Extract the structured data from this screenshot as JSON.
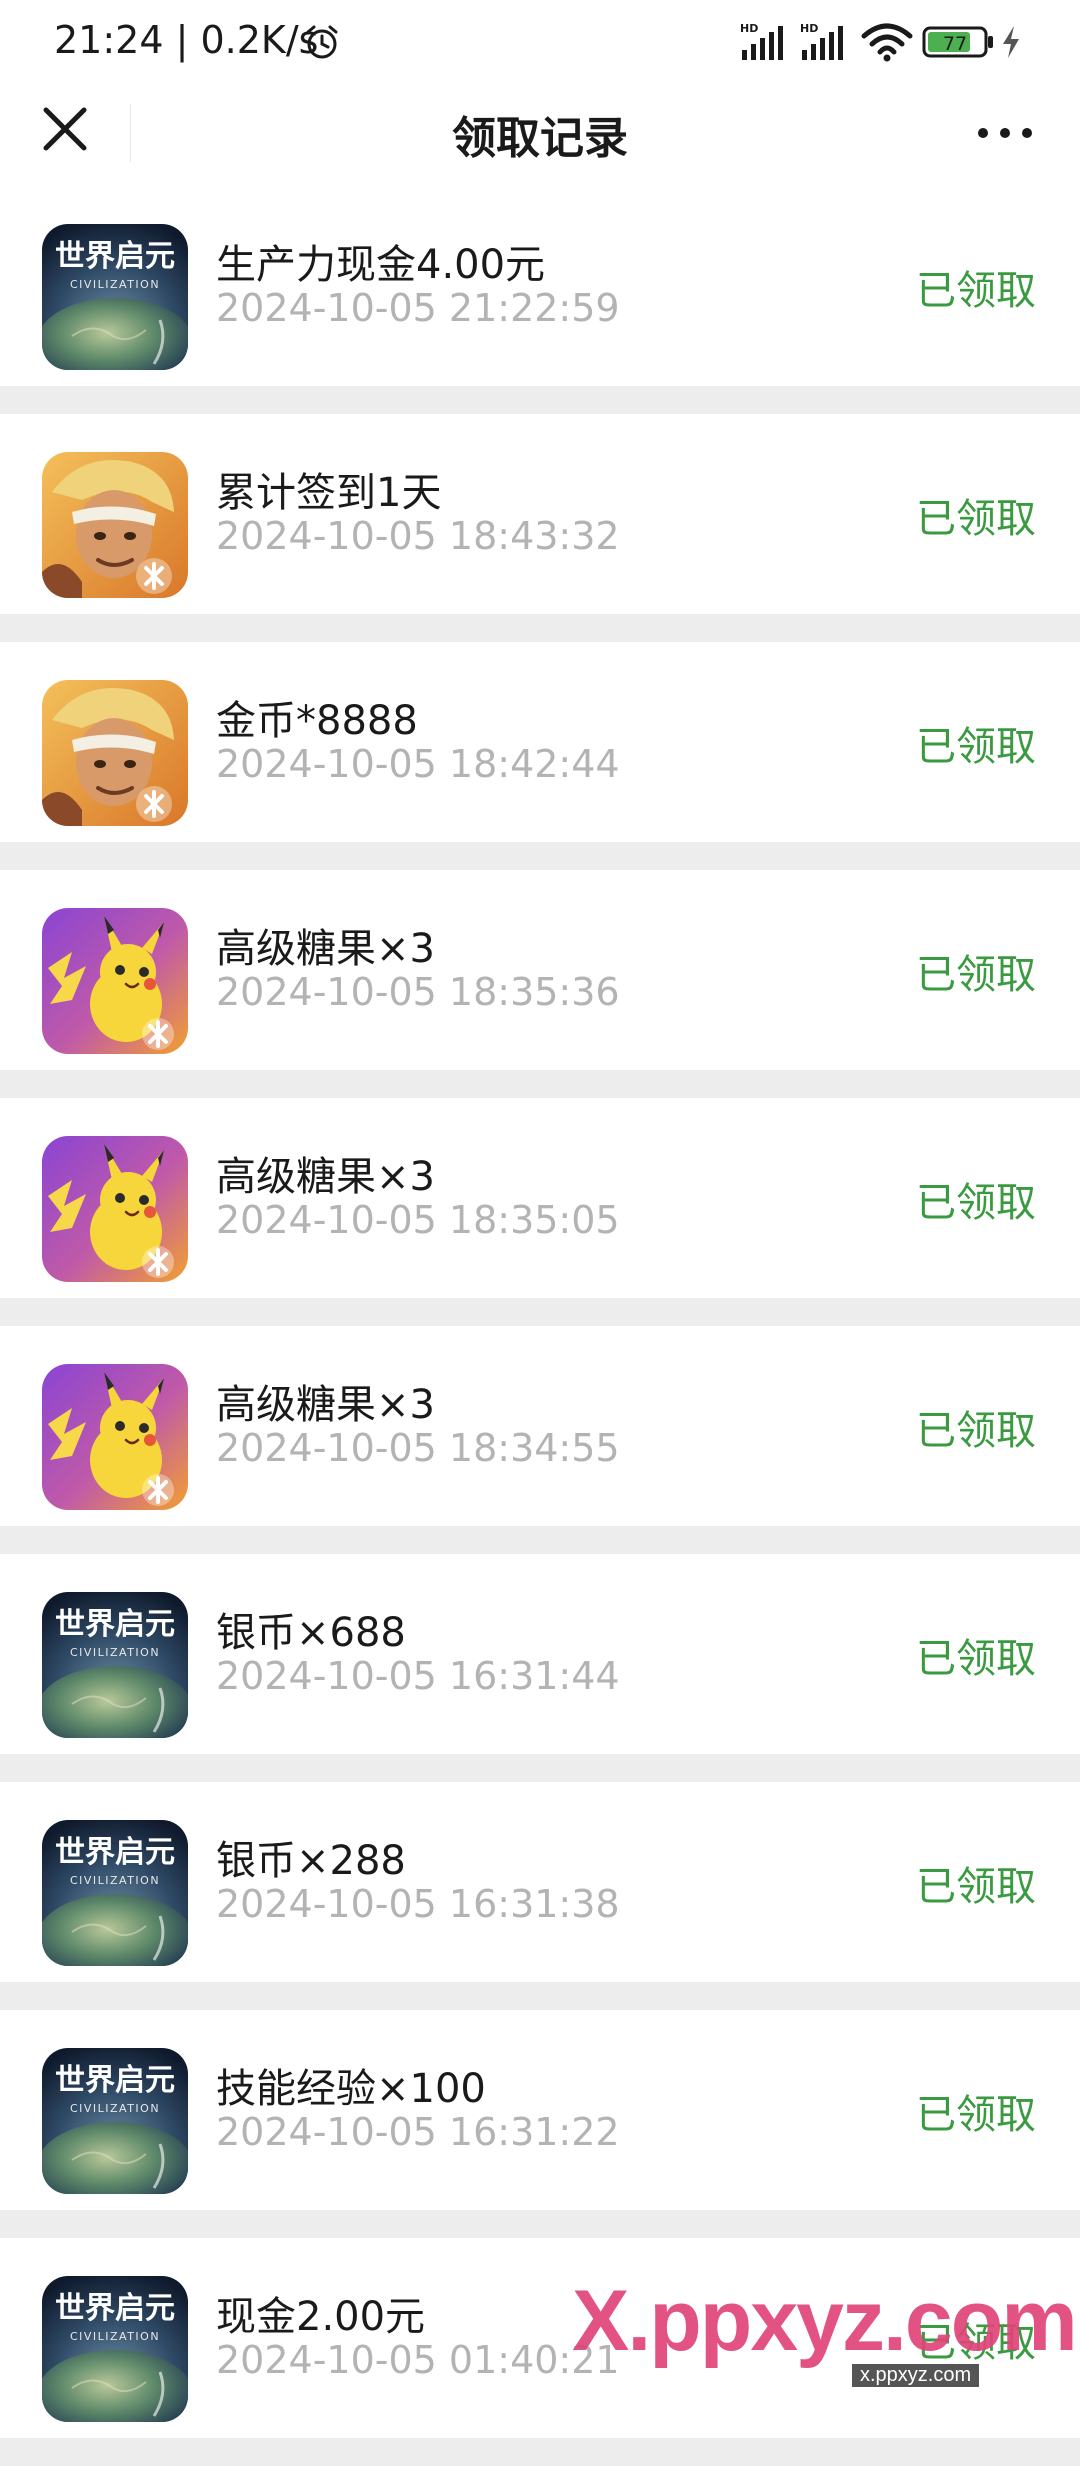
{
  "status_bar": {
    "time": "21:24 | 0.2K/s",
    "signal_1_label": "HD",
    "signal_2_label": "HD",
    "battery_level": "77",
    "battery_color": "#4caf50"
  },
  "header": {
    "title": "领取记录",
    "close_icon": "close-icon",
    "more_icon": "more-icon"
  },
  "colors": {
    "status_received": "#3a9a3f",
    "timestamp": "#b3b3b3",
    "separator": "#ededed"
  },
  "records": [
    {
      "game_icon": "civilization-icon",
      "title": "生产力现金4.00元",
      "time": "2024-10-05 21:22:59",
      "status": "已领取"
    },
    {
      "game_icon": "hero-warrior-icon",
      "title": "累计签到1天",
      "time": "2024-10-05 18:43:32",
      "status": "已领取"
    },
    {
      "game_icon": "hero-warrior-icon",
      "title": "金币*8888",
      "time": "2024-10-05 18:42:44",
      "status": "已领取"
    },
    {
      "game_icon": "pikachu-icon",
      "title": "高级糖果×3",
      "time": "2024-10-05 18:35:36",
      "status": "已领取"
    },
    {
      "game_icon": "pikachu-icon",
      "title": "高级糖果×3",
      "time": "2024-10-05 18:35:05",
      "status": "已领取"
    },
    {
      "game_icon": "pikachu-icon",
      "title": "高级糖果×3",
      "time": "2024-10-05 18:34:55",
      "status": "已领取"
    },
    {
      "game_icon": "civilization-icon",
      "title": "银币×688",
      "time": "2024-10-05 16:31:44",
      "status": "已领取"
    },
    {
      "game_icon": "civilization-icon",
      "title": "银币×288",
      "time": "2024-10-05 16:31:38",
      "status": "已领取"
    },
    {
      "game_icon": "civilization-icon",
      "title": "技能经验×100",
      "time": "2024-10-05 16:31:22",
      "status": "已领取"
    },
    {
      "game_icon": "civilization-icon",
      "title": "现金2.00元",
      "time": "2024-10-05 01:40:21",
      "status": "已领取"
    }
  ],
  "icon_text": {
    "civilization_cn": "世界启元",
    "civilization_en": "CIVILIZATION"
  },
  "watermark": {
    "main": "X.ppxyz.com",
    "sub": "x.ppxyz.com"
  }
}
